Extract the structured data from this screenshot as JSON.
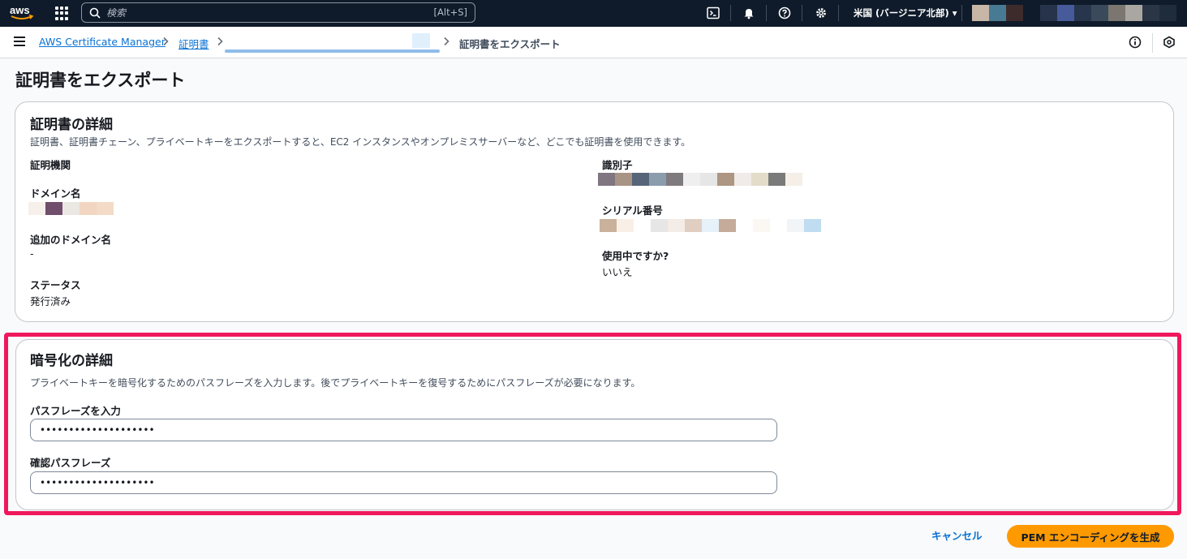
{
  "topnav": {
    "logo_text": "aws",
    "search_placeholder": "検索",
    "search_shortcut": "[Alt+S]",
    "region": "米国 (バージニア北部) ▾",
    "account_pixels": [
      "#c8b6a6",
      "#497a93",
      "#3d2b2b",
      "#0f1b2a",
      "#26334a",
      "#475a9a",
      "#28364d",
      "#3b4a5b",
      "#7b7670",
      "#aaa7a2",
      "#2a3545",
      "#1f2c3c"
    ]
  },
  "breadcrumb": {
    "items": [
      "AWS Certificate Manager",
      "証明書"
    ],
    "current": "証明書をエクスポート"
  },
  "page": {
    "title": "証明書をエクスポート"
  },
  "cert_details": {
    "title": "証明書の詳細",
    "description": "証明書、証明書チェーン、プライベートキーをエクスポートすると、EC2 インスタンスやオンプレミスサーバーなど、どこでも証明書を使用できます。",
    "authority_label": "証明機関",
    "domain_label": "ドメイン名",
    "domain_pixels": [
      "#f6efea",
      "#704e6c",
      "#ebe7e2",
      "#f2d6c2",
      "#f3dbc7"
    ],
    "additional_domains_label": "追加のドメイン名",
    "additional_domains_value": "-",
    "status_label": "ステータス",
    "status_value": "発行済み",
    "identifier_label": "識別子",
    "identifier_pixels": [
      "#7f7681",
      "#a89485",
      "#566578",
      "#8b9cad",
      "#7f7a7d",
      "#efeff0",
      "#e6e6e6",
      "#ad9682",
      "#f0ebe8",
      "#e2dcc8",
      "#7a7a7b",
      "#f5efe7"
    ],
    "serial_label": "シリアル番号",
    "serial_pixels": [
      "#c9b19b",
      "#f9efe6",
      "#ffffff",
      "#e6e6e6",
      "#f3ece7",
      "#e0cfc1",
      "#e6f1f9",
      "#c5ab9a",
      "#ffffff",
      "#fbf8f3",
      "#ffffff",
      "#f2f5f7",
      "#c0dcf0"
    ],
    "in_use_label": "使用中ですか?",
    "in_use_value": "いいえ"
  },
  "encryption": {
    "title": "暗号化の詳細",
    "description": "プライベートキーを暗号化するためのパスフレーズを入力します。後でプライベートキーを復号するためにパスフレーズが必要になります。",
    "passphrase_label": "パスフレーズを入力",
    "passphrase_value": "••••••••••••••••••••",
    "confirm_label": "確認パスフレーズ",
    "confirm_value": "••••••••••••••••••••"
  },
  "actions": {
    "cancel": "キャンセル",
    "generate": "PEM エンコーディングを生成"
  }
}
